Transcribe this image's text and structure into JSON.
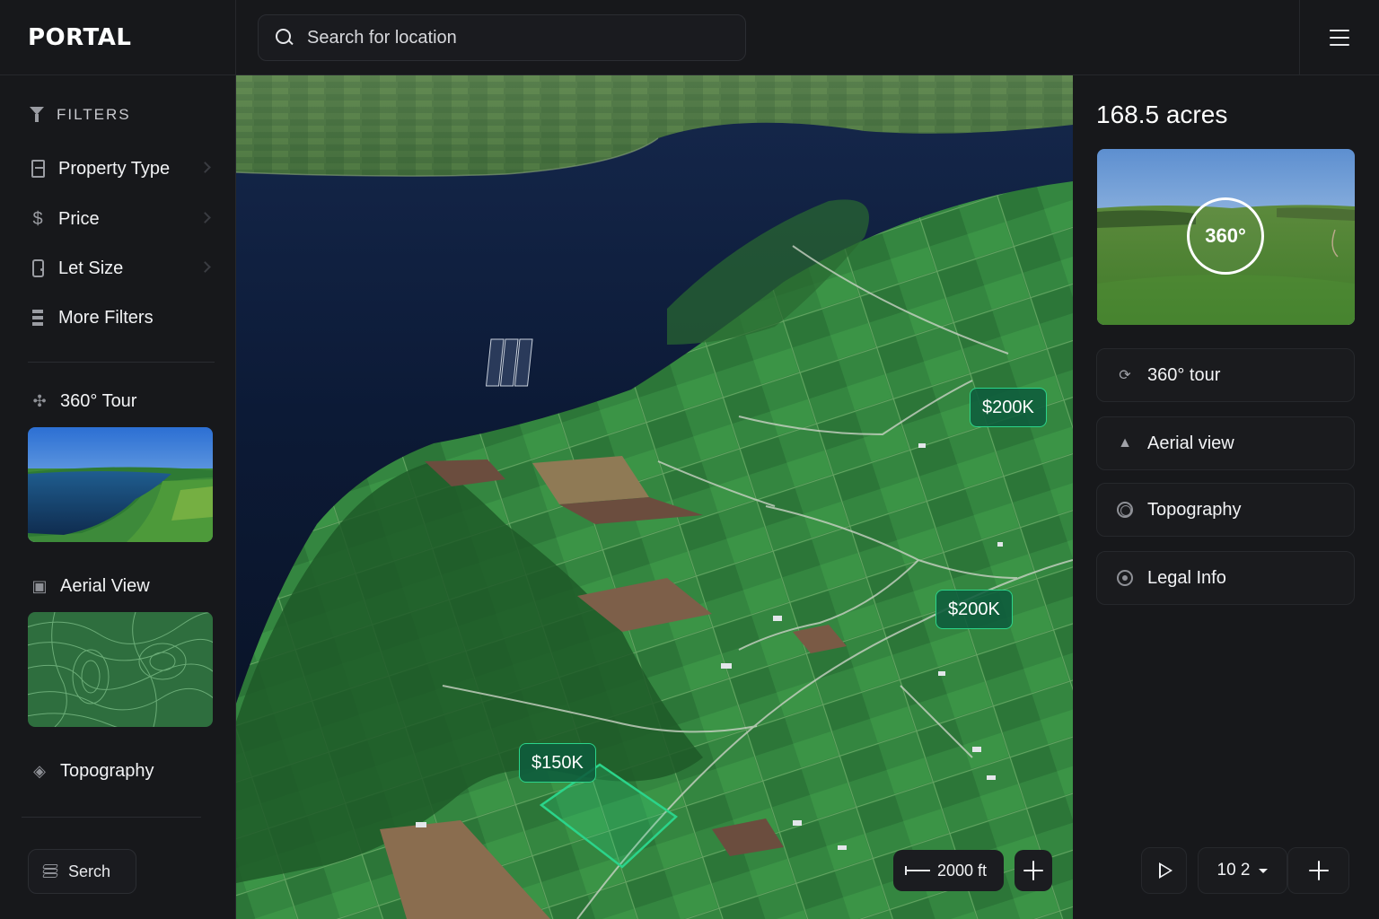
{
  "app": {
    "name": "PORTAL"
  },
  "search": {
    "placeholder": "Search for location"
  },
  "sidebar": {
    "filters_heading": "FILTERS",
    "filters": [
      {
        "label": "Property Type",
        "icon": "document-icon"
      },
      {
        "label": "Price",
        "icon": "dollar-icon"
      },
      {
        "label": "Let Size",
        "icon": "phone-icon"
      },
      {
        "label": "More Filters",
        "icon": "stack-icon"
      }
    ],
    "sections": [
      {
        "label": "360° Tour",
        "icon": "tour-icon"
      },
      {
        "label": "Aerial View",
        "icon": "aerial-icon"
      },
      {
        "label": "Topography",
        "icon": "layers-icon"
      }
    ],
    "search_button": "Serch"
  },
  "map": {
    "price_tags": [
      "$200K",
      "$200K",
      "$150K"
    ],
    "scale_label": "2000 ft"
  },
  "panel": {
    "area": "168.5 acres",
    "pano_label": "360°",
    "buttons": [
      {
        "label": "360° tour",
        "icon": "rotate-icon"
      },
      {
        "label": "Aerial view",
        "icon": "mountain-icon"
      },
      {
        "label": "Topography",
        "icon": "contour-icon"
      },
      {
        "label": "Legal Info",
        "icon": "info-circle-icon"
      }
    ],
    "zoom_level": "10 2"
  },
  "colors": {
    "accent": "#2bd48a",
    "background": "#17181b",
    "field_green": "#2f7a3e",
    "water": "#0e1a36"
  }
}
